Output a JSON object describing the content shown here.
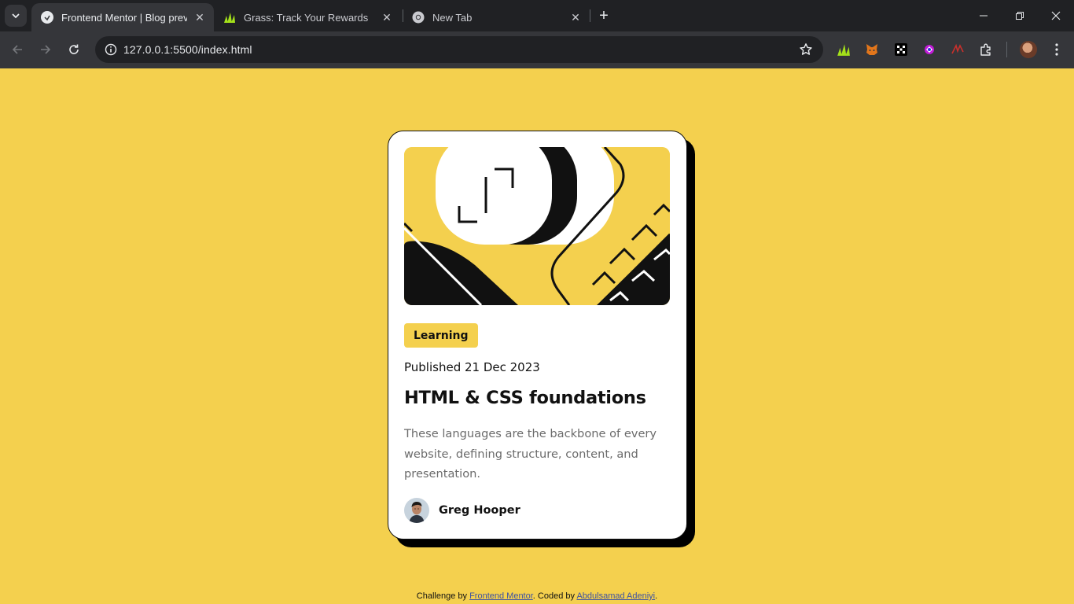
{
  "browser": {
    "tabs": [
      {
        "title": "Frontend Mentor | Blog preview",
        "active": true,
        "favicon": "frontend-mentor-favicon"
      },
      {
        "title": "Grass: Track Your Rewards",
        "active": false,
        "favicon": "grass-favicon"
      },
      {
        "title": "New Tab",
        "active": false,
        "favicon": "chrome-favicon"
      }
    ],
    "url": "127.0.0.1:5500/index.html",
    "extensions": [
      "grass-extension-icon",
      "metamask-extension-icon",
      "okx-extension-icon",
      "purple-extension-icon",
      "red-extension-icon",
      "puzzle-extensions-icon"
    ]
  },
  "card": {
    "tag": "Learning",
    "published": "Published 21 Dec 2023",
    "title": "HTML & CSS foundations",
    "description": "These languages are the backbone of every website, defining structure, content, and presentation.",
    "author": "Greg Hooper"
  },
  "footer": {
    "prefix": "Challenge by ",
    "link1": "Frontend Mentor",
    "middle": ". Coded by ",
    "link2": "Abdulsamad Adeniyi",
    "suffix": "."
  },
  "colors": {
    "background": "#f4d04e",
    "card": "#ffffff",
    "text": "#111111",
    "muted": "#6b6b6b"
  }
}
